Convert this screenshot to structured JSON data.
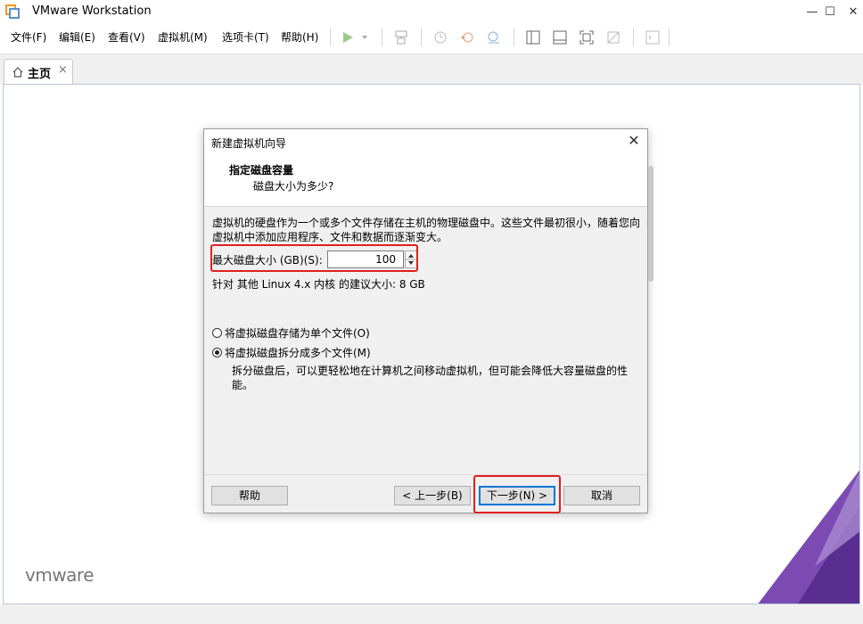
{
  "app": {
    "title": "VMware Workstation"
  },
  "window_controls": {
    "minimize": "—",
    "maximize": "☐",
    "close": "✕"
  },
  "menu": [
    "文件(F)",
    "编辑(E)",
    "查看(V)",
    "虚拟机(M)",
    "选项卡(T)",
    "帮助(H)"
  ],
  "tabs": [
    {
      "label": "主页",
      "close": "×"
    }
  ],
  "dialog": {
    "title": "新建虚拟机向导",
    "close": "✕",
    "heading": "指定磁盘容量",
    "subheading": "磁盘大小为多少?",
    "description": "虚拟机的硬盘作为一个或多个文件存储在主机的物理磁盘中。这些文件最初很小，随着您向虚拟机中添加应用程序、文件和数据而逐渐变大。",
    "max_size_label": "最大磁盘大小 (GB)(S):",
    "max_size_value": "100",
    "recommend": "针对 其他 Linux 4.x 内核 的建议大小: 8 GB",
    "options": [
      {
        "label": "将虚拟磁盘存储为单个文件(O)",
        "selected": false
      },
      {
        "label": "将虚拟磁盘拆分成多个文件(M)",
        "selected": true
      }
    ],
    "split_description": "拆分磁盘后，可以更轻松地在计算机之间移动虚拟机，但可能会降低大容量磁盘的性能。",
    "buttons": {
      "help": "帮助",
      "back": "< 上一步(B)",
      "next": "下一步(N) >",
      "cancel": "取消"
    }
  },
  "brand": {
    "logo": "vmware"
  },
  "colors": {
    "highlight": "#e02020",
    "accent": "#0078d7",
    "brand_purple": "#6b3fa0"
  }
}
